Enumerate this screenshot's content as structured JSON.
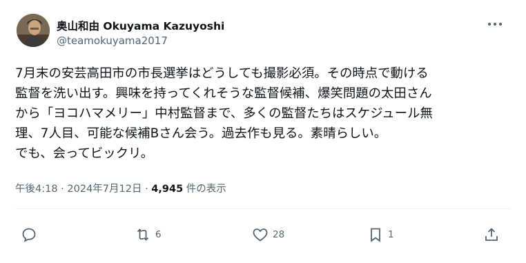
{
  "author": {
    "name": "奥山和由 Okuyama Kazuyoshi",
    "handle": "@teamokuyama2017"
  },
  "tweet": {
    "lines": [
      "7月末の安芸高田市の市長選挙はどうしても撮影必須。その時点で動ける",
      "監督を洗い出す。興味を持ってくれそうな監督候補、爆笑問題の太田さん",
      "から「ヨコハマメリー」中村監督まで、多くの監督たちはスケジュール無",
      "理、7人目、可能な候補Bさん会う。過去作も見る。素晴らしい。",
      "でも、会ってビックリ。"
    ]
  },
  "meta": {
    "time": "午後4:18",
    "separator": "·",
    "date": "2024年7月12日",
    "views_count": "4,945",
    "views_label": "件の表示"
  },
  "actions": {
    "reply_count": "",
    "retweet_count": "6",
    "like_count": "28",
    "bookmark_count": "1"
  },
  "icons": {
    "more": "more-dots-icon",
    "reply": "reply-icon",
    "retweet": "retweet-icon",
    "like": "heart-icon",
    "bookmark": "bookmark-icon",
    "share": "share-icon"
  },
  "colors": {
    "text": "#0f1419",
    "secondary": "#536471",
    "divider": "#eff3f4"
  }
}
